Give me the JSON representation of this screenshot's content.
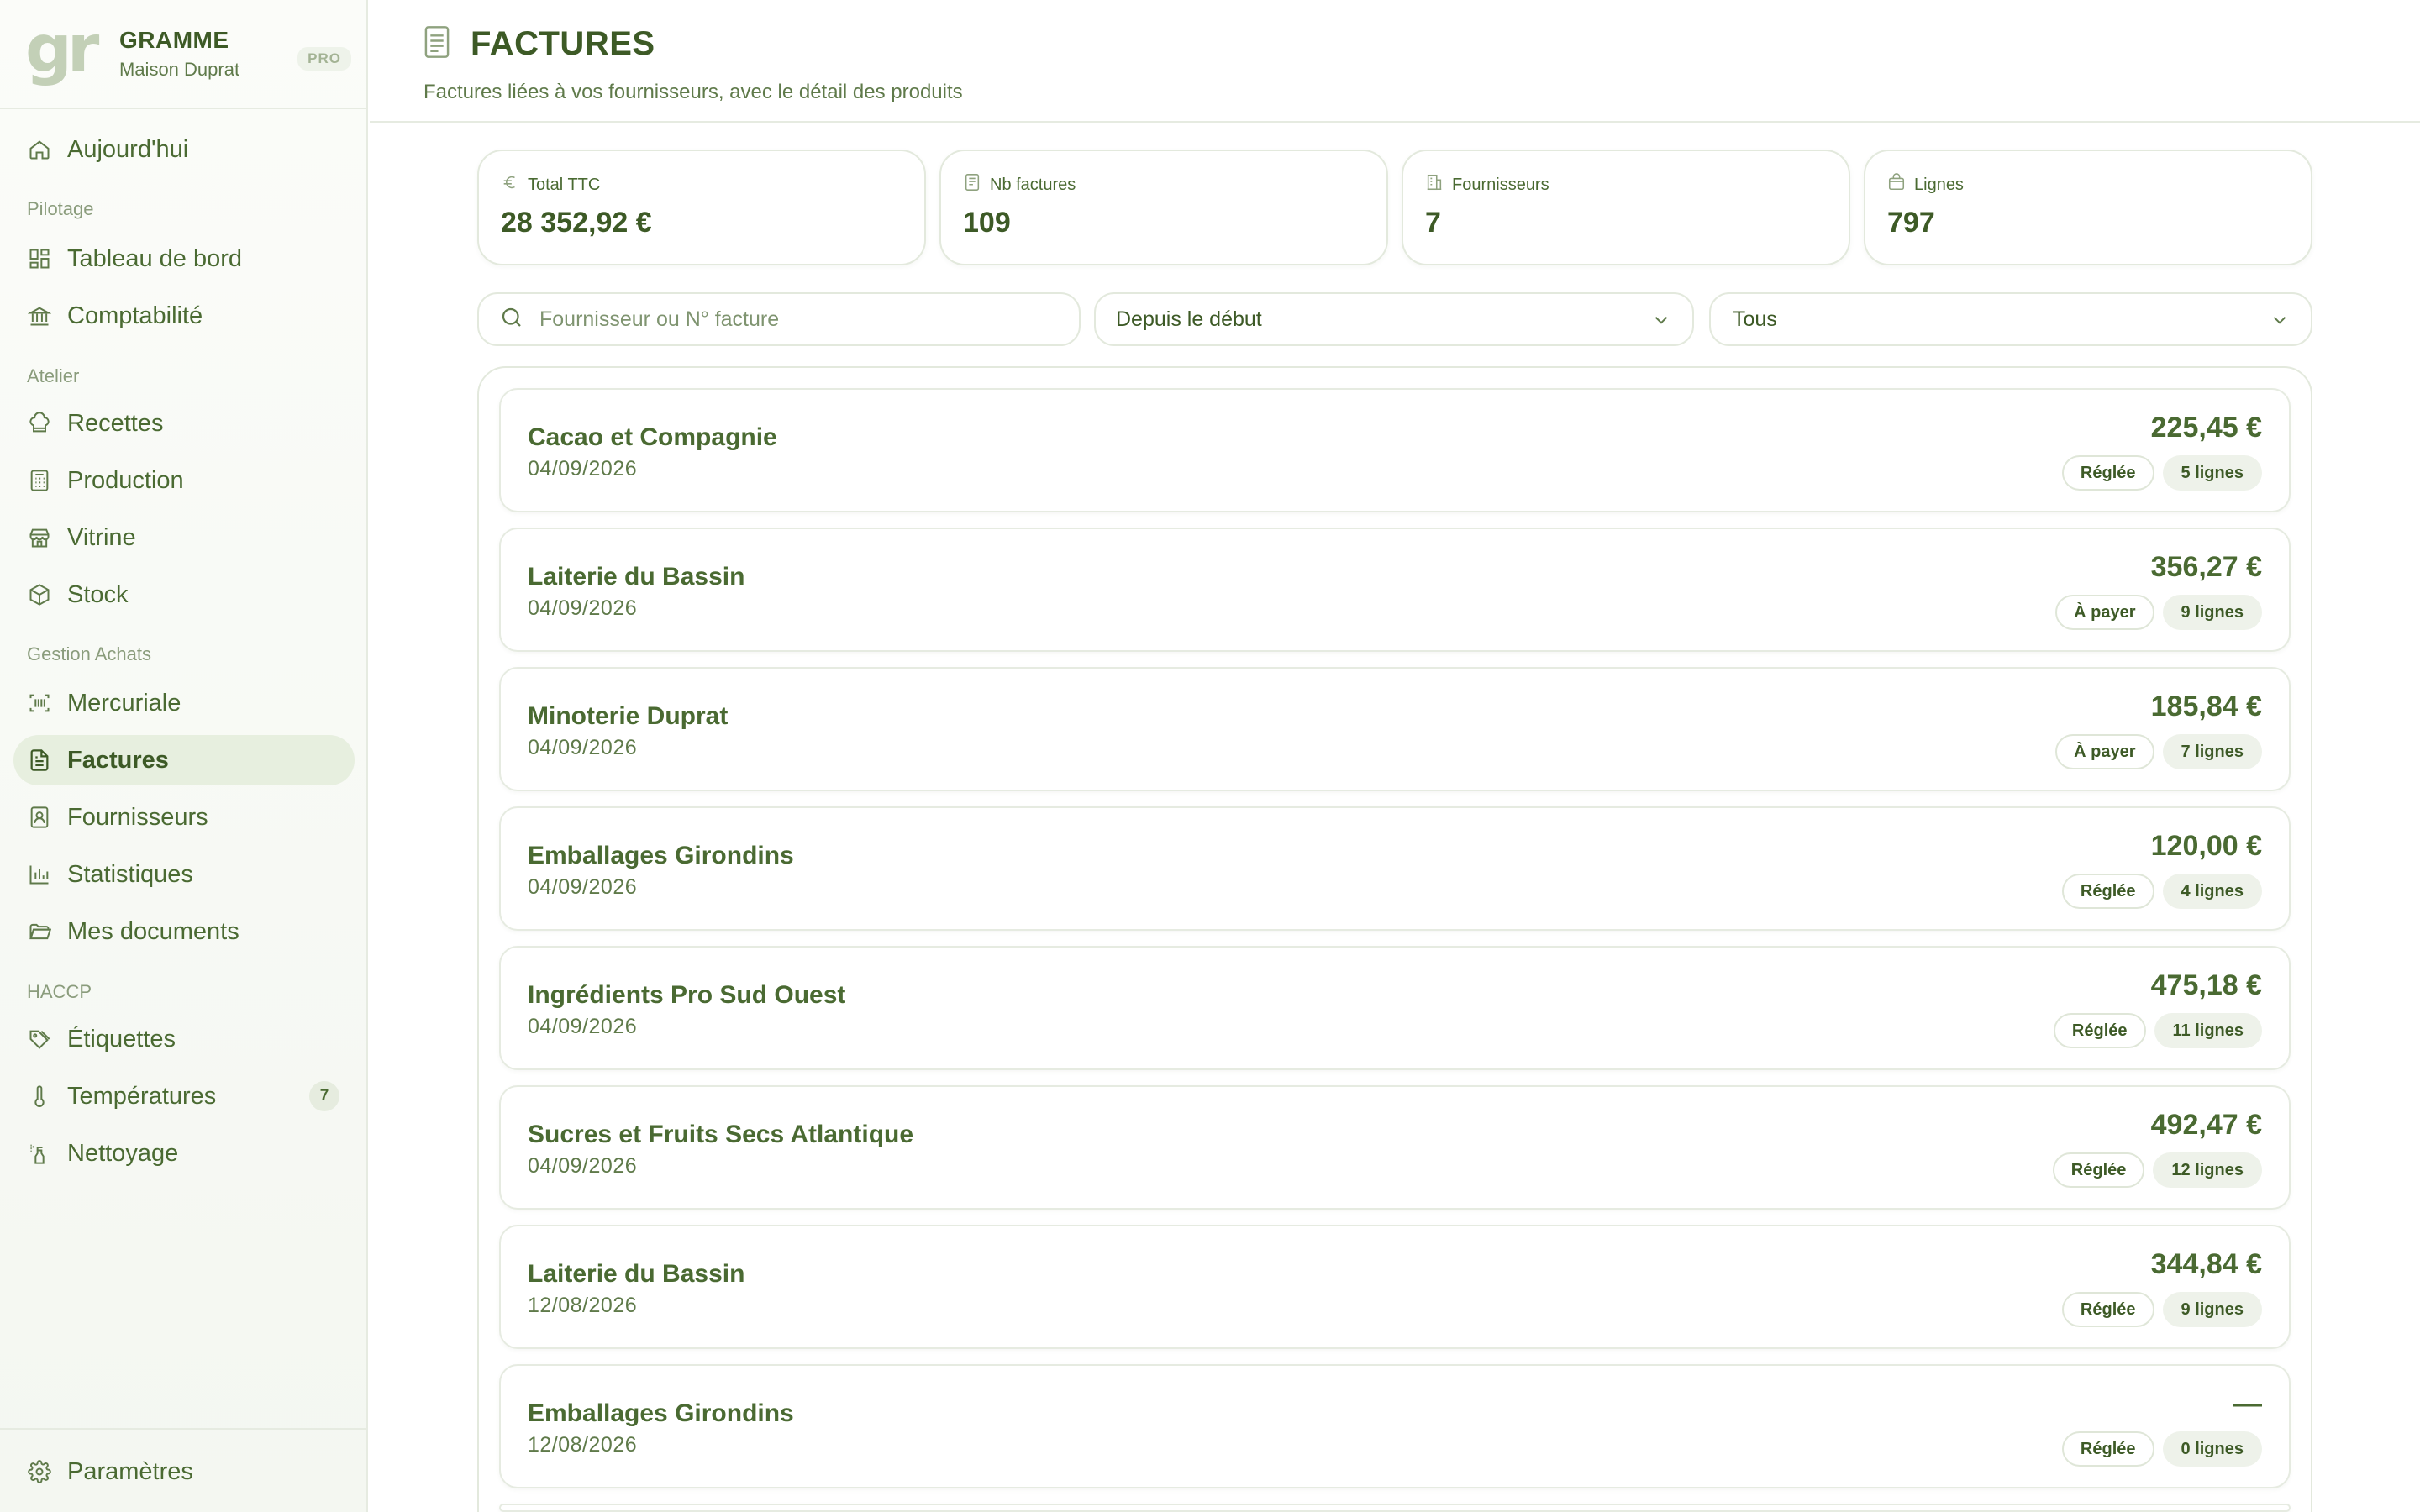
{
  "brand": {
    "logo": "gr",
    "name": "GRAMME",
    "subtitle": "Maison Duprat",
    "plan": "PRO"
  },
  "nav": {
    "today": "Aujourd'hui",
    "sections": {
      "pilotage": "Pilotage",
      "atelier": "Atelier",
      "achats": "Gestion Achats",
      "haccp": "HACCP"
    },
    "items": {
      "dashboard": "Tableau de bord",
      "accounting": "Comptabilité",
      "recipes": "Recettes",
      "production": "Production",
      "showcase": "Vitrine",
      "stock": "Stock",
      "mercuriale": "Mercuriale",
      "invoices": "Factures",
      "suppliers": "Fournisseurs",
      "stats": "Statistiques",
      "documents": "Mes documents",
      "labels": "Étiquettes",
      "temperatures": "Températures",
      "temperatures_badge": "7",
      "cleaning": "Nettoyage"
    },
    "settings": "Paramètres"
  },
  "header": {
    "title": "FACTURES",
    "subtitle": "Factures liées à vos fournisseurs, avec le détail des produits"
  },
  "stats": {
    "total": {
      "label": "Total TTC",
      "value": "28 352,92 €"
    },
    "count": {
      "label": "Nb factures",
      "value": "109"
    },
    "suppliers": {
      "label": "Fournisseurs",
      "value": "7"
    },
    "lines": {
      "label": "Lignes",
      "value": "797"
    }
  },
  "filters": {
    "search_placeholder": "Fournisseur ou N° facture",
    "period": "Depuis le début",
    "status": "Tous"
  },
  "invoices": [
    {
      "supplier": "Cacao et Compagnie",
      "date": "04/09/2026",
      "amount": "225,45 €",
      "status": "Réglée",
      "lines": "5 lignes"
    },
    {
      "supplier": "Laiterie du Bassin",
      "date": "04/09/2026",
      "amount": "356,27 €",
      "status": "À payer",
      "lines": "9 lignes"
    },
    {
      "supplier": "Minoterie Duprat",
      "date": "04/09/2026",
      "amount": "185,84 €",
      "status": "À payer",
      "lines": "7 lignes"
    },
    {
      "supplier": "Emballages Girondins",
      "date": "04/09/2026",
      "amount": "120,00 €",
      "status": "Réglée",
      "lines": "4 lignes"
    },
    {
      "supplier": "Ingrédients Pro Sud Ouest",
      "date": "04/09/2026",
      "amount": "475,18 €",
      "status": "Réglée",
      "lines": "11 lignes"
    },
    {
      "supplier": "Sucres et Fruits Secs Atlantique",
      "date": "04/09/2026",
      "amount": "492,47 €",
      "status": "Réglée",
      "lines": "12 lignes"
    },
    {
      "supplier": "Laiterie du Bassin",
      "date": "12/08/2026",
      "amount": "344,84 €",
      "status": "Réglée",
      "lines": "9 lignes"
    },
    {
      "supplier": "Emballages Girondins",
      "date": "12/08/2026",
      "amount": "—",
      "status": "Réglée",
      "lines": "0 lignes"
    }
  ]
}
